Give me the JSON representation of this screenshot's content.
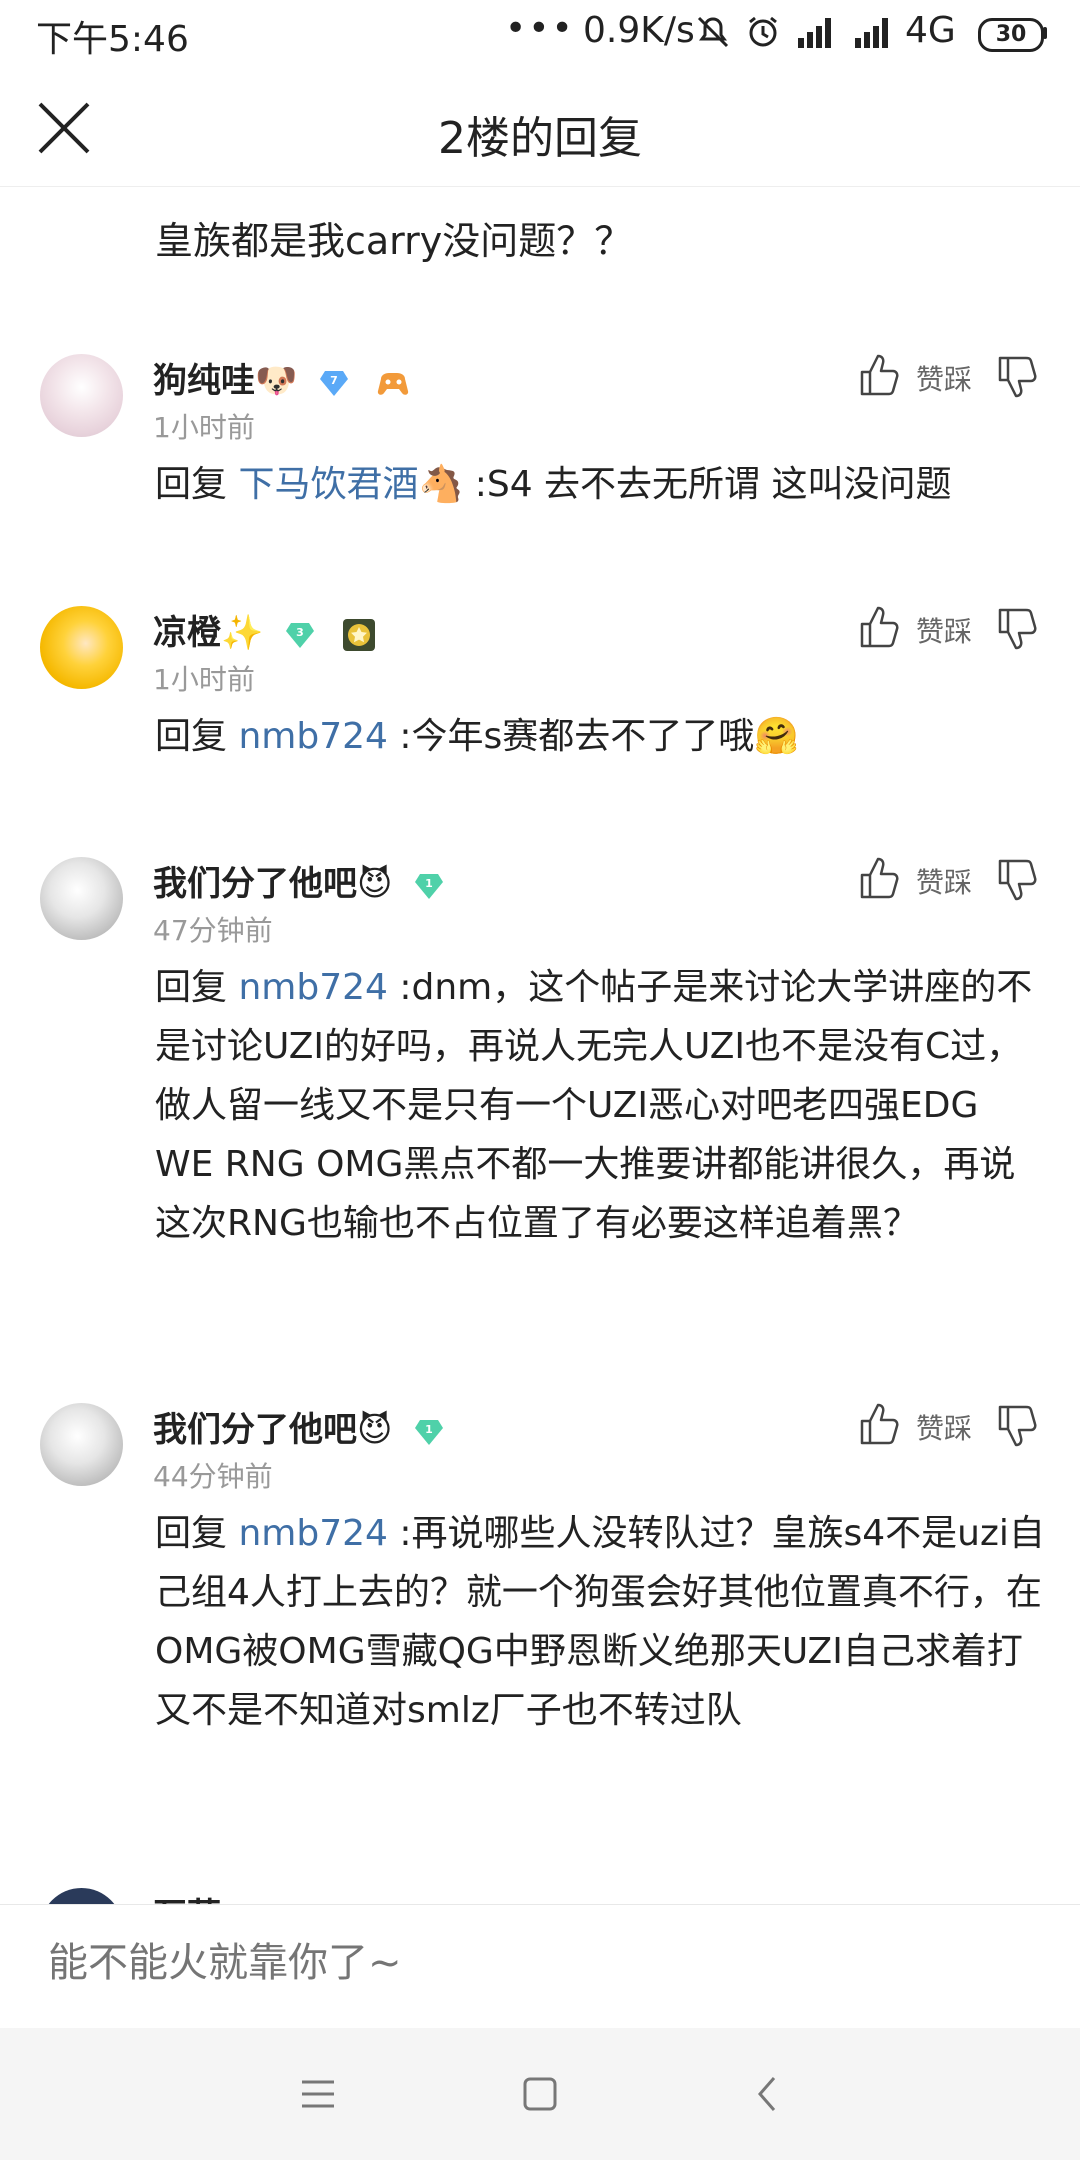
{
  "status_bar": {
    "time": "下午5:46",
    "dots": "•••",
    "net_speed": "0.9K/s",
    "network": "4G",
    "battery": "30"
  },
  "header": {
    "title": "2楼的回复",
    "close_icon": "close-icon"
  },
  "top_text": "皇族都是我carry没问题？？",
  "vote_label": "赞踩",
  "comments": [
    {
      "username": "狗纯哇",
      "emoji": "🐶",
      "level": "7",
      "level_color": "#5aa9f7",
      "time": "1小时前",
      "reply_prefix": "回复 ",
      "mention": "下马饮君酒🐴",
      "text": " :S4 去不去无所谓 这叫没问题"
    },
    {
      "username": "凉橙",
      "emoji": "✨",
      "level": "3",
      "level_color": "#4fd1a9",
      "time": "1小时前",
      "reply_prefix": "回复 ",
      "mention": "nmb724",
      "text": " :今年s赛都去不了了哦🤗"
    },
    {
      "username": "我们分了他吧",
      "emoji": "😈",
      "level": "1",
      "level_color": "#4fd1a9",
      "time": "47分钟前",
      "reply_prefix": "回复 ",
      "mention": "nmb724",
      "text": " :dnm，这个帖子是来讨论大学讲座的不是讨论UZI的好吗，再说人无完人UZI也不是没有C过，做人留一线又不是只有一个UZI恶心对吧老四强EDG WE RNG OMG黑点不都一大推要讲都能讲很久，再说这次RNG也输也不占位置了有必要这样追着黑？"
    },
    {
      "username": "我们分了他吧",
      "emoji": "😈",
      "level": "1",
      "level_color": "#4fd1a9",
      "time": "44分钟前",
      "reply_prefix": "回复 ",
      "mention": "nmb724",
      "text": " :再说哪些人没转队过？皇族s4不是uzi自己组4人打上去的？就一个狗蛋会好其他位置真不行，在OMG被OMG雪藏QG中野恩断义绝那天UZI自己求着打又不是不知道对smlz厂子也不转过队"
    }
  ],
  "partial_comment": {
    "username": "瓦薇s"
  },
  "input": {
    "placeholder": "能不能火就靠你了~"
  },
  "nav": {
    "menu_icon": "menu-icon",
    "home_icon": "home-icon",
    "back_icon": "back-icon"
  }
}
